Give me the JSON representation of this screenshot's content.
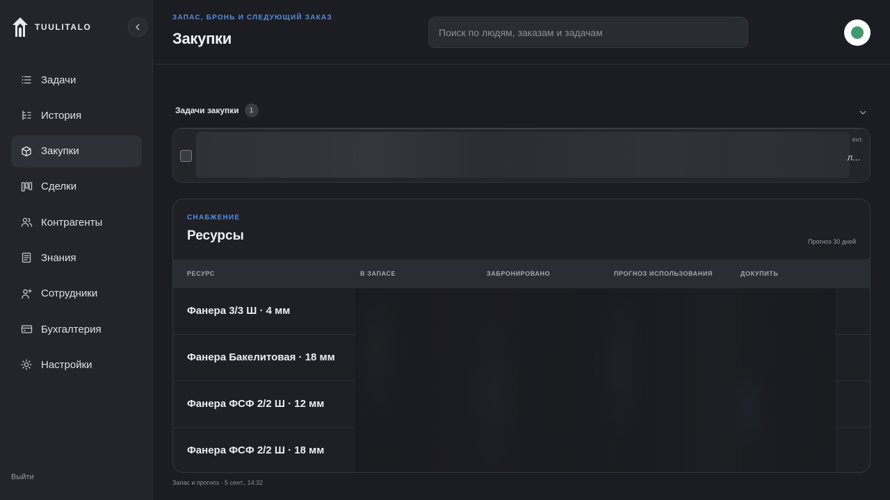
{
  "app": {
    "brand": "TUULITALO",
    "accent": "#4f8fe6",
    "avatar_color": "#3f9a6e"
  },
  "sidebar": {
    "collapse_icon": "chevron-left-icon",
    "items": [
      {
        "label": "Задачи",
        "icon": "list-icon",
        "active": false
      },
      {
        "label": "История",
        "icon": "history-icon",
        "active": false
      },
      {
        "label": "Закупки",
        "icon": "box-icon",
        "active": true
      },
      {
        "label": "Сделки",
        "icon": "kanban-icon",
        "active": false
      },
      {
        "label": "Контрагенты",
        "icon": "users-icon",
        "active": false
      },
      {
        "label": "Знания",
        "icon": "document-icon",
        "active": false
      },
      {
        "label": "Сотрудники",
        "icon": "user-plus-icon",
        "active": false
      },
      {
        "label": "Бухгалтерия",
        "icon": "card-icon",
        "active": false
      },
      {
        "label": "Настройки",
        "icon": "gear-icon",
        "active": false
      }
    ],
    "logout_label": "Выйти"
  },
  "header": {
    "eyebrow": "ЗАПАС, БРОНЬ И СЛЕДУЮЩИЙ ЗАКАЗ",
    "title": "Закупки",
    "search_placeholder": "Поиск по людям, заказам и задачам",
    "search_value": ""
  },
  "tasks": {
    "title": "Задачи закупки",
    "count": "1",
    "toggle_icon": "chevron-down-icon",
    "card_meta_top": "ент.",
    "card_meta_bottom": "л..."
  },
  "resources": {
    "eyebrow": "СНАБЖЕНИЕ",
    "title": "Ресурсы",
    "forecast_label": "Прогноз 30 дней",
    "columns": [
      "РЕСУРС",
      "В ЗАПАСЕ",
      "ЗАБРОНИРОВАНО",
      "ПРОГНОЗ ИСПОЛЬЗОВАНИЯ",
      "ДОКУПИТЬ"
    ],
    "rows": [
      {
        "name": "Фанера 3/3 Ш · 4 мм"
      },
      {
        "name": "Фанера Бакелитовая · 18 мм"
      },
      {
        "name": "Фанера ФСФ 2/2 Ш · 12 мм"
      },
      {
        "name": "Фанера ФСФ 2/2 Ш · 18 мм"
      }
    ]
  },
  "footer": {
    "note": "Запас и прогноз · 5 сент., 14:32"
  }
}
